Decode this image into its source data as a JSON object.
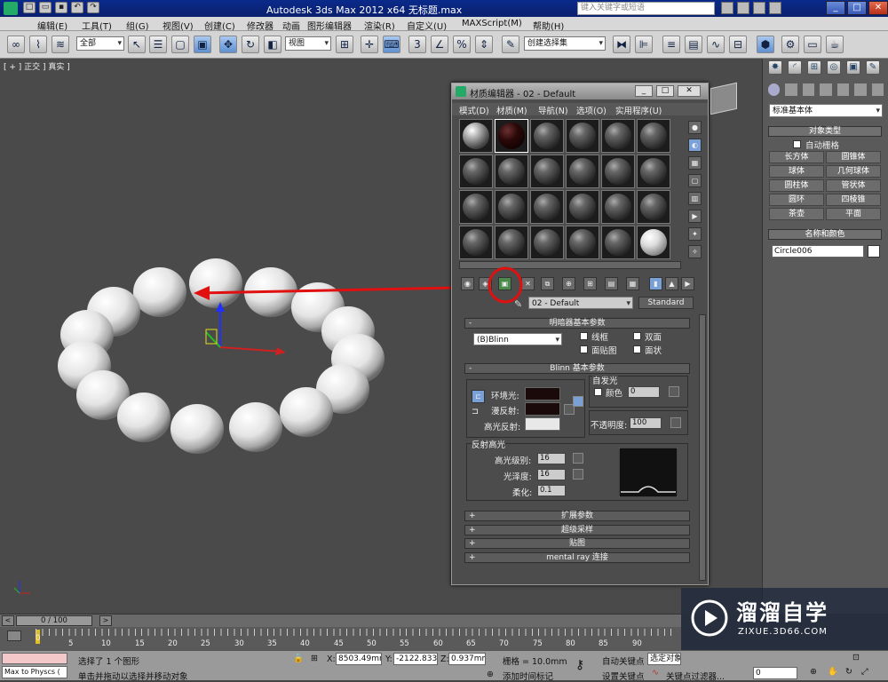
{
  "titlebar": {
    "app_title": "Autodesk 3ds Max  2012 x64      无标题.max",
    "search_placeholder": "键入关键字或短语",
    "window_buttons": [
      "_",
      "□",
      "✕"
    ]
  },
  "menu": [
    "编辑(E)",
    "工具(T)",
    "组(G)",
    "视图(V)",
    "创建(C)",
    "修改器",
    "动画",
    "图形编辑器",
    "渲染(R)",
    "自定义(U)",
    "MAXScript(M)",
    "帮助(H)"
  ],
  "toolbar": {
    "selection_filter": "全部",
    "ref_coord": "视图",
    "named_selection": "创建选择集",
    "snap_3": "3",
    "percent_snap": "%"
  },
  "viewport": {
    "label": "[ + ] 正交 ] 真实 ]"
  },
  "command_panel": {
    "category_dropdown": "标准基本体",
    "object_type_header": "对象类型",
    "autogrid_label": "自动栅格",
    "primitives": [
      "长方体",
      "圆锥体",
      "球体",
      "几何球体",
      "圆柱体",
      "管状体",
      "圆环",
      "四棱锥",
      "茶壶",
      "平面"
    ],
    "name_color_header": "名称和颜色",
    "object_name": "Circle006",
    "object_color": "#ffffff"
  },
  "material_editor": {
    "title": "材质编辑器 - 02 - Default",
    "menu": [
      "模式(D)",
      "材质(M)",
      "导航(N)",
      "选项(O)",
      "实用程序(U)"
    ],
    "material_name": "02 - Default",
    "material_type": "Standard",
    "shader_section": "明暗器基本参数",
    "shader_type": "(B)Blinn",
    "shader_options": [
      "线框",
      "双面",
      "面贴图",
      "面状"
    ],
    "blinn_section": "Blinn 基本参数",
    "self_illum_label": "自发光",
    "color_label": "颜色",
    "self_illum_value": "0",
    "ambient_label": "环境光:",
    "diffuse_label": "漫反射:",
    "specular_label": "高光反射:",
    "opacity_label": "不透明度:",
    "opacity_value": "100",
    "specular_highlights_label": "反射高光",
    "specular_level_label": "高光级别:",
    "specular_level_value": "16",
    "glossiness_label": "光泽度:",
    "glossiness_value": "16",
    "soften_label": "柔化:",
    "soften_value": "0.1",
    "collapsed_sections": [
      "扩展参数",
      "超级采样",
      "贴图",
      "mental ray 连接"
    ],
    "colors": {
      "ambient": "#1a0a0a",
      "diffuse": "#1a0a0a",
      "specular": "#e8e8e8"
    }
  },
  "timeline": {
    "frame_display": "0 / 100",
    "ticks": [
      "0",
      "5",
      "10",
      "15",
      "20",
      "25",
      "30",
      "35",
      "40",
      "45",
      "50",
      "55",
      "60",
      "65",
      "70",
      "75",
      "80",
      "85",
      "90"
    ]
  },
  "status": {
    "maxscript_listener": "Max to Physcs (",
    "selection_msg": "选择了 1 个图形",
    "prompt_msg": "单击并拖动以选择并移动对象",
    "x_value": "8503.49mm",
    "y_value": "-2122.833",
    "z_value": "0.937mm",
    "grid": "栅格 = 10.0mm",
    "add_time_tag": "添加时间标记",
    "auto_key": "自动关键点",
    "set_key": "设置关键点",
    "selected_dropdown": "选定对象",
    "key_filters": "关键点过滤器...",
    "frame_spinner": "0"
  },
  "watermark": {
    "brand": "溜溜自学",
    "url": "ZIXUE.3D66.COM"
  },
  "accent_red": "#e01010"
}
